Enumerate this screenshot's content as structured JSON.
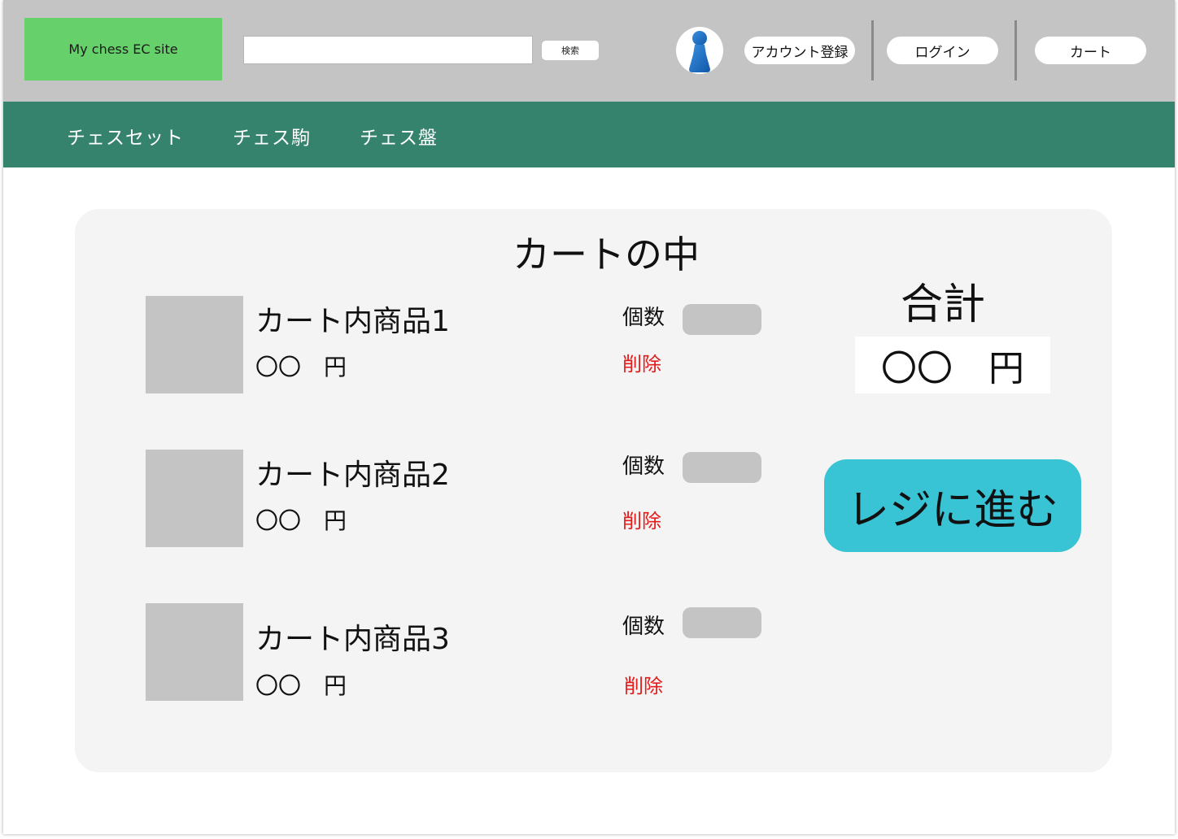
{
  "header": {
    "logo": "My chess EC site",
    "search": {
      "value": "",
      "placeholder": "",
      "button_label": "検索"
    },
    "account_register": "アカウント登録",
    "login": "ログイン",
    "cart": "カート"
  },
  "nav": {
    "items": [
      {
        "label": "チェスセット"
      },
      {
        "label": "チェス駒"
      },
      {
        "label": "チェス盤"
      }
    ]
  },
  "cart": {
    "title": "カートの中",
    "items": [
      {
        "name": "カート内商品1",
        "price": "〇〇　円",
        "qty_label": "個数",
        "delete_label": "削除"
      },
      {
        "name": "カート内商品2",
        "price": "〇〇　円",
        "qty_label": "個数",
        "delete_label": "削除"
      },
      {
        "name": "カート内商品3",
        "price": "〇〇　円",
        "qty_label": "個数",
        "delete_label": "削除"
      }
    ],
    "total_label": "合計",
    "total_value": "〇〇　円",
    "checkout_label": "レジに進む"
  },
  "colors": {
    "header_bg": "#c4c4c4",
    "logo_bg": "#66d06a",
    "nav_bg": "#35826d",
    "panel_bg": "#f4f4f4",
    "delete_text": "#e31b1b",
    "checkout_bg": "#38c4d5",
    "placeholder_gray": "#c4c4c4"
  },
  "icons": {
    "avatar": "person-pawn-icon"
  }
}
